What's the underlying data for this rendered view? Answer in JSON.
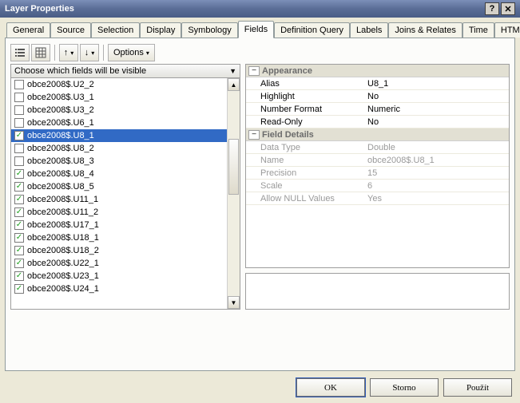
{
  "window": {
    "title": "Layer Properties"
  },
  "tabs": [
    "General",
    "Source",
    "Selection",
    "Display",
    "Symbology",
    "Fields",
    "Definition Query",
    "Labels",
    "Joins & Relates",
    "Time",
    "HTML Popup"
  ],
  "active_tab_index": 5,
  "options_label": "Options",
  "left": {
    "header": "Choose which fields will be visible",
    "fields": [
      {
        "name": "obce2008$.U2_2",
        "checked": false
      },
      {
        "name": "obce2008$.U3_1",
        "checked": false
      },
      {
        "name": "obce2008$.U3_2",
        "checked": false
      },
      {
        "name": "obce2008$.U6_1",
        "checked": false
      },
      {
        "name": "obce2008$.U8_1",
        "checked": true,
        "selected": true
      },
      {
        "name": "obce2008$.U8_2",
        "checked": false
      },
      {
        "name": "obce2008$.U8_3",
        "checked": false
      },
      {
        "name": "obce2008$.U8_4",
        "checked": true
      },
      {
        "name": "obce2008$.U8_5",
        "checked": true
      },
      {
        "name": "obce2008$.U11_1",
        "checked": true
      },
      {
        "name": "obce2008$.U11_2",
        "checked": true
      },
      {
        "name": "obce2008$.U17_1",
        "checked": true
      },
      {
        "name": "obce2008$.U18_1",
        "checked": true
      },
      {
        "name": "obce2008$.U18_2",
        "checked": true
      },
      {
        "name": "obce2008$.U22_1",
        "checked": true
      },
      {
        "name": "obce2008$.U23_1",
        "checked": true
      },
      {
        "name": "obce2008$.U24_1",
        "checked": true
      }
    ]
  },
  "right": {
    "groups": [
      {
        "title": "Appearance",
        "rows": [
          {
            "label": "Alias",
            "value": "U8_1"
          },
          {
            "label": "Highlight",
            "value": "No"
          },
          {
            "label": "Number Format",
            "value": "Numeric"
          },
          {
            "label": "Read-Only",
            "value": "No"
          }
        ]
      },
      {
        "title": "Field Details",
        "disabled": true,
        "rows": [
          {
            "label": "Data Type",
            "value": "Double"
          },
          {
            "label": "Name",
            "value": "obce2008$.U8_1"
          },
          {
            "label": "Precision",
            "value": "15"
          },
          {
            "label": "Scale",
            "value": "6"
          },
          {
            "label": "Allow NULL Values",
            "value": "Yes"
          }
        ]
      }
    ]
  },
  "buttons": {
    "ok": "OK",
    "cancel": "Storno",
    "apply": "Použít"
  }
}
